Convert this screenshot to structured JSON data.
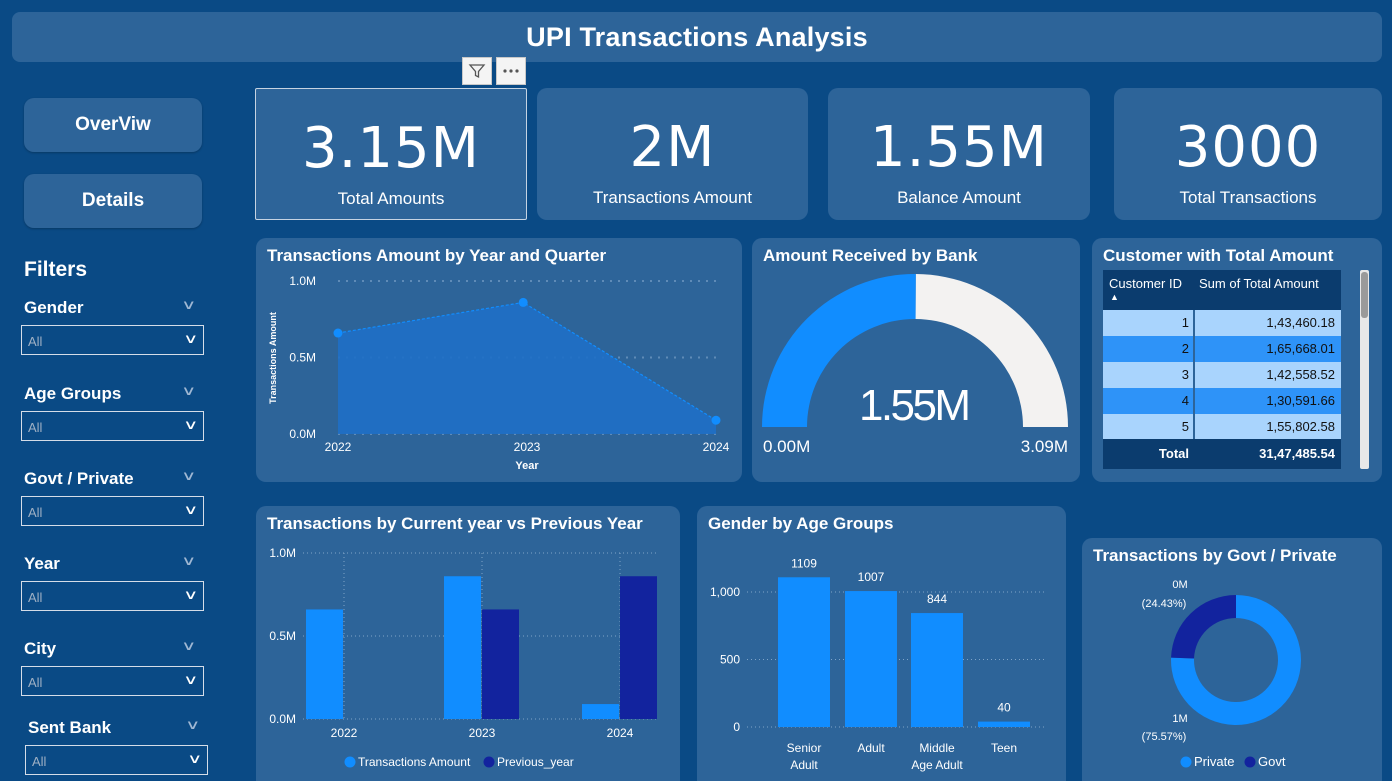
{
  "header": {
    "title": "UPI Transactions Analysis"
  },
  "nav": {
    "overview_label": "OverViw",
    "details_label": "Details"
  },
  "visual_toolbar": {
    "filter_icon": "filter-icon",
    "more_icon": "more-options-icon"
  },
  "filters": {
    "heading": "Filters",
    "items": [
      {
        "label": "Gender",
        "value": "All"
      },
      {
        "label": "Age Groups",
        "value": "All"
      },
      {
        "label": "Govt / Private",
        "value": "All"
      },
      {
        "label": "Year",
        "value": "All"
      },
      {
        "label": "City",
        "value": "All"
      },
      {
        "label": "Sent Bank",
        "value": "All"
      }
    ]
  },
  "kpis": [
    {
      "value": "3.15M",
      "label": "Total Amounts"
    },
    {
      "value": "2M",
      "label": "Transactions Amount"
    },
    {
      "value": "1.55M",
      "label": "Balance Amount"
    },
    {
      "value": "3000",
      "label": "Total Transactions"
    }
  ],
  "table": {
    "title": "Customer with Total Amount",
    "col1": "Customer ID",
    "col2": "Sum of Total Amount",
    "rows": [
      {
        "id": "1",
        "amount": "1,43,460.18"
      },
      {
        "id": "2",
        "amount": "1,65,668.01"
      },
      {
        "id": "3",
        "amount": "1,42,558.52"
      },
      {
        "id": "4",
        "amount": "1,30,591.66"
      },
      {
        "id": "5",
        "amount": "1,55,802.58"
      }
    ],
    "total_label": "Total",
    "total_value": "31,47,485.54"
  },
  "colors": {
    "background": "#0a4a85",
    "panel": "#2d6499",
    "primary": "#118dff",
    "secondary": "#12239e",
    "gauge_track": "#f3f2f1"
  },
  "chart_data": [
    {
      "id": "area",
      "type": "area",
      "title": "Transactions Amount by Year and Quarter",
      "xlabel": "Year",
      "ylabel": "Transactions Amount",
      "categories": [
        "2022",
        "2023",
        "2024"
      ],
      "x": [
        2022.0,
        2022.98,
        2024.0
      ],
      "values": [
        0.66,
        0.86,
        0.09
      ],
      "yticks": [
        "0.0M",
        "0.5M",
        "1.0M"
      ],
      "ylim": [
        0,
        1.0
      ],
      "grid": true
    },
    {
      "id": "gauge",
      "type": "gauge",
      "title": "Amount Received by Bank",
      "value": 1.55,
      "min": 0,
      "max": 3.09,
      "value_label": "1.55M",
      "min_label": "0.00M",
      "max_label": "3.09M"
    },
    {
      "id": "cy_py",
      "type": "bar",
      "title": "Transactions by Current year vs Previous Year",
      "categories": [
        "2022",
        "2023",
        "2024"
      ],
      "series": [
        {
          "name": "Transactions Amount",
          "values": [
            0.66,
            0.86,
            0.09
          ]
        },
        {
          "name": "Previous_year",
          "values": [
            0,
            0.66,
            0.86
          ]
        }
      ],
      "yticks": [
        "0.0M",
        "0.5M",
        "1.0M"
      ],
      "ylim": [
        0,
        1.0
      ],
      "legend": "bottom"
    },
    {
      "id": "gender_age",
      "type": "bar",
      "title": "Gender by Age Groups",
      "categories": [
        "Senior Adult",
        "Adult",
        "Middle Age Adult",
        "Teen"
      ],
      "values": [
        1109,
        1007,
        844,
        40
      ],
      "data_labels": [
        "1109",
        "1007",
        "844",
        "40"
      ],
      "yticks": [
        "0",
        "500",
        "1,000"
      ],
      "ylim": [
        0,
        1200
      ]
    },
    {
      "id": "donut",
      "type": "pie",
      "title": "Transactions by Govt / Private",
      "slices": [
        {
          "name": "Private",
          "pct": 75.57,
          "value_label": "1M",
          "pct_label": "(75.57%)"
        },
        {
          "name": "Govt",
          "pct": 24.43,
          "value_label": "0M",
          "pct_label": "(24.43%)"
        }
      ],
      "legend": "bottom"
    }
  ]
}
